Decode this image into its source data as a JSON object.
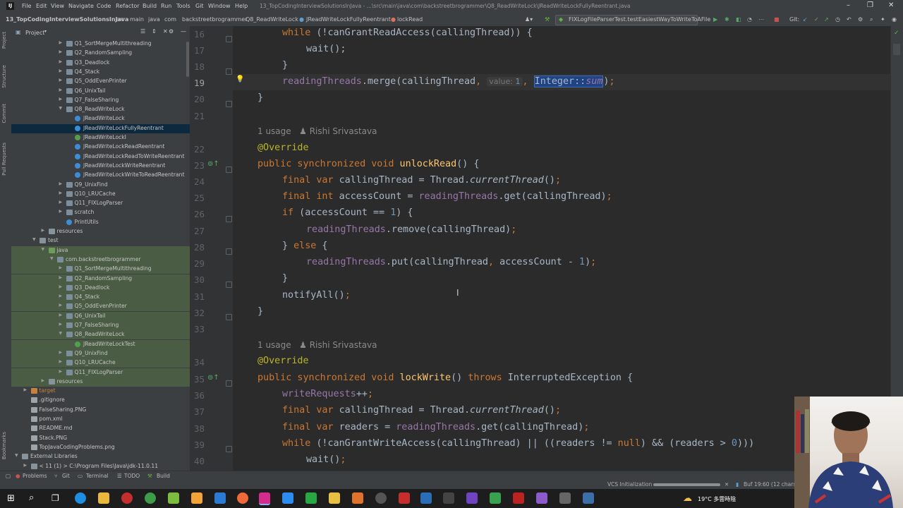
{
  "window": {
    "menu": [
      "File",
      "Edit",
      "View",
      "Navigate",
      "Code",
      "Refactor",
      "Build",
      "Run",
      "Tools",
      "Git",
      "Window",
      "Help"
    ],
    "title": "13_TopCodingInterviewSolutionsInJava - ...\\src\\main\\java\\com\\backstreetbrogrammer\\Q8_ReadWriteLock\\JReadWriteLockFullyReentrant.java"
  },
  "breadcrumb": [
    "13_TopCodingInterviewSolutionsInJava",
    "src",
    "main",
    "java",
    "com",
    "backstreetbrogrammer",
    "Q8_ReadWriteLock",
    "JReadWriteLockFullyReentrant",
    "lockRead"
  ],
  "run_config": "FIXLogFileParserTest.testEasiestWayToWriteToAFile",
  "git_label": "Git:",
  "left_tabs": [
    "Project",
    "Structure",
    "Commit",
    "Pull Requests",
    "Bookmarks"
  ],
  "project": {
    "title": "Project",
    "rows": [
      {
        "label": "Q1_SortMergeMultithreading",
        "type": "pkg",
        "depth": 5,
        "arrow": ">"
      },
      {
        "label": "Q2_RandomSampling",
        "type": "pkg",
        "depth": 5,
        "arrow": ">"
      },
      {
        "label": "Q3_Deadlock",
        "type": "pkg",
        "depth": 5,
        "arrow": ">"
      },
      {
        "label": "Q4_Stack",
        "type": "pkg",
        "depth": 5,
        "arrow": ">"
      },
      {
        "label": "Q5_OddEvenPrinter",
        "type": "pkg",
        "depth": 5,
        "arrow": ">"
      },
      {
        "label": "Q6_UnixTail",
        "type": "pkg",
        "depth": 5,
        "arrow": ">"
      },
      {
        "label": "Q7_FalseSharing",
        "type": "pkg",
        "depth": 5,
        "arrow": ">"
      },
      {
        "label": "Q8_ReadWriteLock",
        "type": "pkg",
        "depth": 5,
        "arrow": "v"
      },
      {
        "label": "JReadWriteLock",
        "type": "cls",
        "depth": 6,
        "arrow": ""
      },
      {
        "label": "JReadWriteLockFullyReentrant",
        "type": "cls",
        "depth": 6,
        "arrow": "",
        "selected": true
      },
      {
        "label": "JReadWriteLockI",
        "type": "clsg",
        "depth": 6,
        "arrow": ""
      },
      {
        "label": "JReadWriteLockReadReentrant",
        "type": "cls",
        "depth": 6,
        "arrow": ""
      },
      {
        "label": "JReadWriteLockReadToWriteReentrant",
        "type": "cls",
        "depth": 6,
        "arrow": ""
      },
      {
        "label": "JReadWriteLockWriteReentrant",
        "type": "cls",
        "depth": 6,
        "arrow": ""
      },
      {
        "label": "JReadWriteLockWriteToReadReentrant",
        "type": "cls",
        "depth": 6,
        "arrow": ""
      },
      {
        "label": "Q9_UnixFind",
        "type": "pkg",
        "depth": 5,
        "arrow": ">"
      },
      {
        "label": "Q10_LRUCache",
        "type": "pkg",
        "depth": 5,
        "arrow": ">"
      },
      {
        "label": "Q11_FIXLogParser",
        "type": "pkg",
        "depth": 5,
        "arrow": ">"
      },
      {
        "label": "scratch",
        "type": "pkg",
        "depth": 5,
        "arrow": ">"
      },
      {
        "label": "PrintUtils",
        "type": "cls",
        "depth": 5,
        "arrow": ""
      },
      {
        "label": "resources",
        "type": "folder",
        "depth": 3,
        "arrow": ">"
      },
      {
        "label": "test",
        "type": "folder",
        "depth": 2,
        "arrow": "v"
      },
      {
        "label": "java",
        "type": "test",
        "depth": 3,
        "arrow": "v",
        "testbg": true
      },
      {
        "label": "com.backstreetbrogrammer",
        "type": "pkg",
        "depth": 4,
        "arrow": "v",
        "testbg": true
      },
      {
        "label": "Q1_SortMergeMultithreading",
        "type": "pkg",
        "depth": 5,
        "arrow": ">",
        "testbg": true
      },
      {
        "label": "Q2_RandomSampling",
        "type": "pkg",
        "depth": 5,
        "arrow": ">",
        "testbg": true
      },
      {
        "label": "Q3_Deadlock",
        "type": "pkg",
        "depth": 5,
        "arrow": ">",
        "testbg": true
      },
      {
        "label": "Q4_Stack",
        "type": "pkg",
        "depth": 5,
        "arrow": ">",
        "testbg": true
      },
      {
        "label": "Q5_OddEvenPrinter",
        "type": "pkg",
        "depth": 5,
        "arrow": ">",
        "testbg": true
      },
      {
        "label": "Q6_UnixTail",
        "type": "pkg",
        "depth": 5,
        "arrow": ">",
        "testbg": true
      },
      {
        "label": "Q7_FalseSharing",
        "type": "pkg",
        "depth": 5,
        "arrow": ">",
        "testbg": true
      },
      {
        "label": "Q8_ReadWriteLock",
        "type": "pkg",
        "depth": 5,
        "arrow": "v",
        "testbg": true
      },
      {
        "label": "JReadWriteLockTest",
        "type": "clsg",
        "depth": 6,
        "arrow": "",
        "testbg": true
      },
      {
        "label": "Q9_UnixFind",
        "type": "pkg",
        "depth": 5,
        "arrow": ">",
        "testbg": true
      },
      {
        "label": "Q10_LRUCache",
        "type": "pkg",
        "depth": 5,
        "arrow": ">",
        "testbg": true
      },
      {
        "label": "Q11_FIXLogParser",
        "type": "pkg",
        "depth": 5,
        "arrow": ">",
        "testbg": true
      },
      {
        "label": "resources",
        "type": "folder",
        "depth": 3,
        "arrow": ">",
        "testbg": true
      },
      {
        "label": "target",
        "type": "excl",
        "depth": 1,
        "arrow": ">"
      },
      {
        "label": ".gitignore",
        "type": "file",
        "depth": 1,
        "arrow": ""
      },
      {
        "label": "FalseSharing.PNG",
        "type": "file",
        "depth": 1,
        "arrow": ""
      },
      {
        "label": "pom.xml",
        "type": "file",
        "depth": 1,
        "arrow": ""
      },
      {
        "label": "README.md",
        "type": "file",
        "depth": 1,
        "arrow": ""
      },
      {
        "label": "Stack.PNG",
        "type": "file",
        "depth": 1,
        "arrow": ""
      },
      {
        "label": "TopJavaCodingProblems.png",
        "type": "file",
        "depth": 1,
        "arrow": ""
      },
      {
        "label": "External Libraries",
        "type": "folder",
        "depth": 0,
        "arrow": "v"
      },
      {
        "label": "< 11 (1) >  C:\\Program Files\\Java\\jdk-11.0.11",
        "type": "folder",
        "depth": 1,
        "arrow": ">"
      }
    ]
  },
  "editor": {
    "lines": [
      {
        "n": "16"
      },
      {
        "n": "17"
      },
      {
        "n": "18"
      },
      {
        "n": "19",
        "current": true
      },
      {
        "n": "20"
      },
      {
        "n": "21"
      },
      {
        "n": "22"
      },
      {
        "n": "23"
      },
      {
        "n": "24"
      },
      {
        "n": "25"
      },
      {
        "n": "26"
      },
      {
        "n": "27"
      },
      {
        "n": "28"
      },
      {
        "n": "29"
      },
      {
        "n": "30"
      },
      {
        "n": "31"
      },
      {
        "n": "32"
      },
      {
        "n": "33"
      },
      {
        "n": "34"
      },
      {
        "n": "35"
      },
      {
        "n": "36"
      },
      {
        "n": "37"
      },
      {
        "n": "38"
      },
      {
        "n": "39"
      },
      {
        "n": "40"
      }
    ],
    "usage_1": "1 usage",
    "author_1": "Rishi Srivastava",
    "usage_2": "1 usage",
    "author_2": "Rishi Srivastava",
    "hint_label": "value:",
    "hint_value": "1",
    "selected_text": "Integer::sum"
  },
  "toolwindows": [
    "Problems",
    "Git",
    "Terminal",
    "TODO",
    "Build"
  ],
  "status": {
    "vcs": "VCS Initialization",
    "right": "Buf   19:60 (12 chars"
  },
  "taskbar": {
    "weather": "19°C 多雲時陰"
  },
  "colors": {
    "keyword": "#cc7832",
    "field": "#9876aa",
    "method": "#ffc66d",
    "number": "#6897bb",
    "annotation": "#bbb529",
    "selection": "#214283"
  }
}
